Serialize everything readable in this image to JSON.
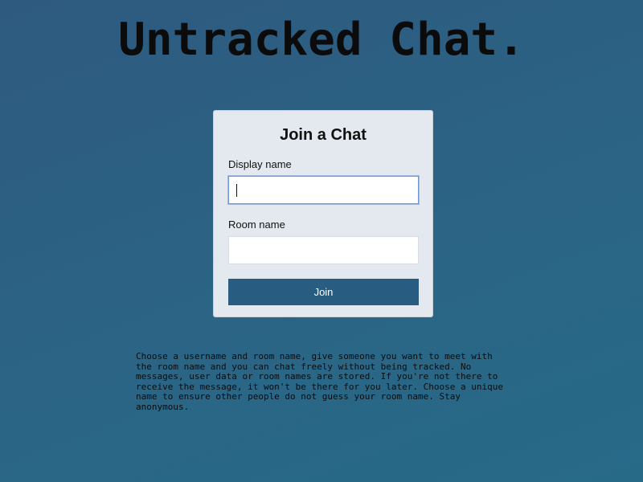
{
  "app": {
    "title": "Untracked Chat."
  },
  "join_form": {
    "heading": "Join a Chat",
    "display_name_label": "Display name",
    "display_name_value": "",
    "room_name_label": "Room name",
    "room_name_value": "",
    "join_button_label": "Join"
  },
  "info": {
    "description": "Choose a username and room name, give someone you want to meet with the room name and you can chat freely without being tracked. No messages, user data or room names are stored. If you're not there to receive the message, it won't be there for you later. Choose a unique name to ensure other people do not guess your room name. Stay anonymous."
  },
  "colors": {
    "background_top": "#2e5a7f",
    "background_bottom": "#276a88",
    "card_background": "#e3e9ee",
    "button_background": "#285c80",
    "focus_border": "#6f95d6"
  }
}
